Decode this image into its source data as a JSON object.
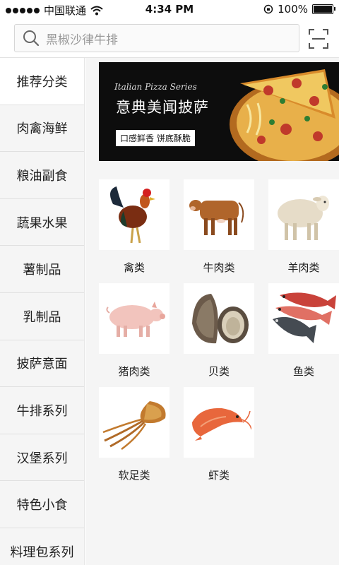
{
  "status_bar": {
    "carrier": "中国联通",
    "time": "4:34 PM",
    "battery": "100%"
  },
  "search": {
    "placeholder": "黑椒沙律牛排"
  },
  "sidebar": {
    "items": [
      {
        "label": "推荐分类",
        "active": true
      },
      {
        "label": "肉禽海鲜"
      },
      {
        "label": "粮油副食"
      },
      {
        "label": "蔬果水果"
      },
      {
        "label": "薯制品"
      },
      {
        "label": "乳制品"
      },
      {
        "label": "披萨意面"
      },
      {
        "label": "牛排系列"
      },
      {
        "label": "汉堡系列"
      },
      {
        "label": "特色小食"
      },
      {
        "label": "料理包系列"
      }
    ]
  },
  "banner": {
    "script": "Italian Pizza Series",
    "title": "意典美闻披萨",
    "subtitle": "口感鲜香 饼底酥脆"
  },
  "categories": [
    {
      "label": "禽类",
      "icon": "rooster-icon"
    },
    {
      "label": "牛肉类",
      "icon": "cow-icon"
    },
    {
      "label": "羊肉类",
      "icon": "sheep-icon"
    },
    {
      "label": "猪肉类",
      "icon": "pig-icon"
    },
    {
      "label": "贝类",
      "icon": "oyster-icon"
    },
    {
      "label": "鱼类",
      "icon": "fish-icon"
    },
    {
      "label": "软足类",
      "icon": "squid-icon"
    },
    {
      "label": "虾类",
      "icon": "shrimp-icon"
    }
  ],
  "colors": {
    "sidebar_bg": "#f5f5f5",
    "active_bg": "#ffffff",
    "banner_bg": "#0d0d0d"
  }
}
